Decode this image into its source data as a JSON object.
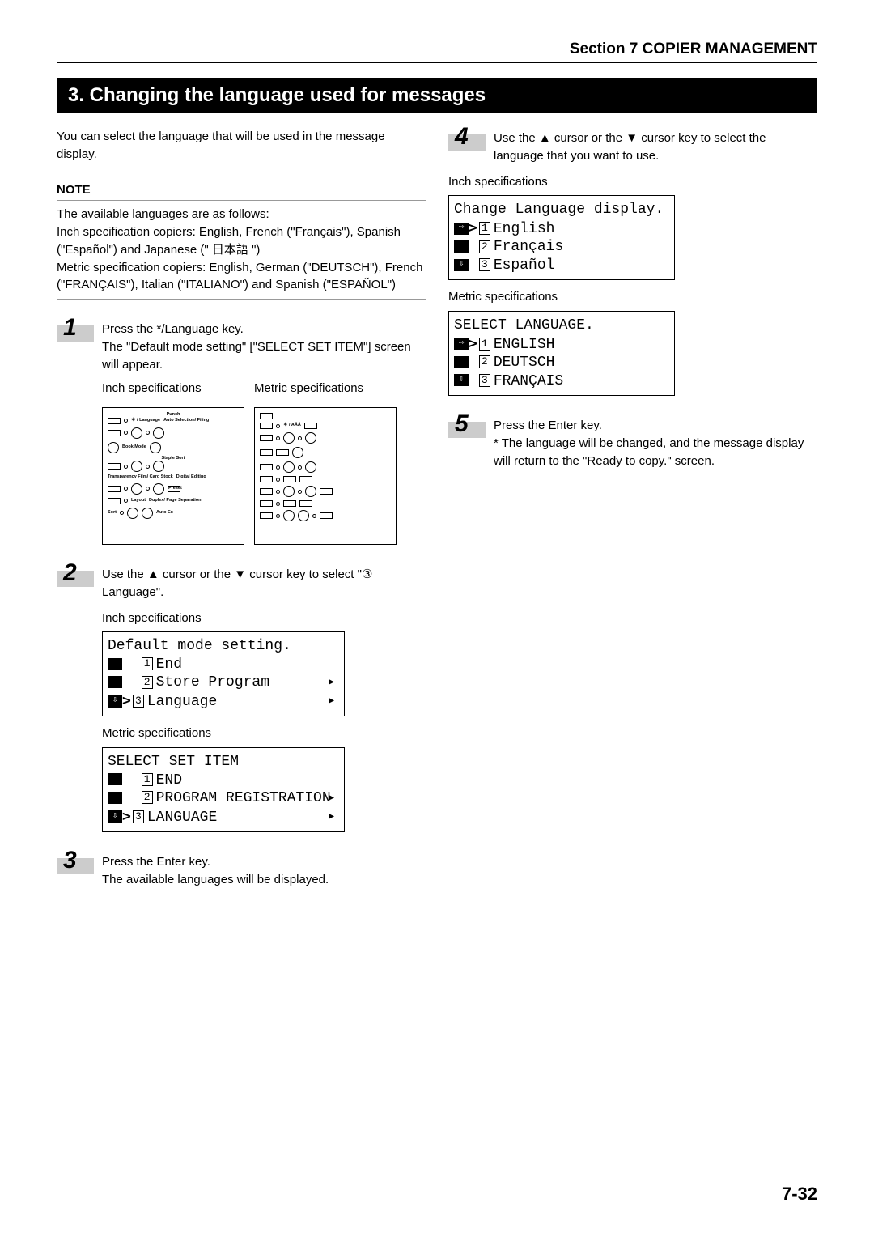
{
  "header": {
    "section": "Section 7  COPIER MANAGEMENT"
  },
  "title": "3. Changing the language used for messages",
  "intro": "You can select the language that will be used in the message display.",
  "note": {
    "label": "NOTE",
    "line1": "The available languages are as follows:",
    "line2": "Inch specification copiers: English, French (\"Français\"), Spanish (\"Español\") and Japanese (\" 日本語 \")",
    "line3": "Metric specification copiers: English, German (\"DEUTSCH\"), French (\"FRANÇAIS\"), Italian (\"ITALIANO\") and Spanish (\"ESPAÑOL\")"
  },
  "steps": {
    "s1": {
      "num": "1",
      "text": "Press the */Language key.\nThe \"Default mode setting\" [\"SELECT SET ITEM\"] screen will appear."
    },
    "s2": {
      "num": "2",
      "text": "Use the ▲ cursor or the ▼ cursor key to select \"③ Language\"."
    },
    "s3": {
      "num": "3",
      "text": "Press the Enter key.\nThe available languages will be displayed."
    },
    "s4": {
      "num": "4",
      "text": "Use the ▲ cursor or the ▼ cursor key to select the language that you want to use."
    },
    "s5": {
      "num": "5",
      "text": "Press the Enter key.\n* The language will be changed, and the message display will return to the \"Ready to copy.\" screen."
    }
  },
  "labels": {
    "inch": "Inch specifications",
    "metric": "Metric specifications"
  },
  "panel_inch": {
    "punch": "Punch",
    "lang": "＊ / Language",
    "auto_sel": "Auto Selection/ Filing",
    "book_mode": "Book Mode",
    "staple_sort": "Staple Sort",
    "trans": "Transparency Film/ Card Stock",
    "digital": "Digital Editing",
    "preset": "Preset",
    "layout": "Layout",
    "duplex": "Duplex/ Page Separation",
    "sort": "Sort",
    "auto_ex": "Auto Ex"
  },
  "panel_metric": {
    "star": "＊ / AÄÅ"
  },
  "lcd2_inch": {
    "title": "Default mode setting.",
    "i1": "End",
    "i2": "Store Program",
    "i3": "Language"
  },
  "lcd2_metric": {
    "title": "SELECT SET ITEM",
    "i1": "END",
    "i2": "PROGRAM REGISTRATION",
    "i3": "LANGUAGE"
  },
  "lcd4_inch": {
    "title": "Change Language display.",
    "i1": "English",
    "i2": "Français",
    "i3": "Español"
  },
  "lcd4_metric": {
    "title": "SELECT LANGUAGE.",
    "i1": "ENGLISH",
    "i2": "DEUTSCH",
    "i3": "FRANÇAIS"
  },
  "page_num": "7-32"
}
